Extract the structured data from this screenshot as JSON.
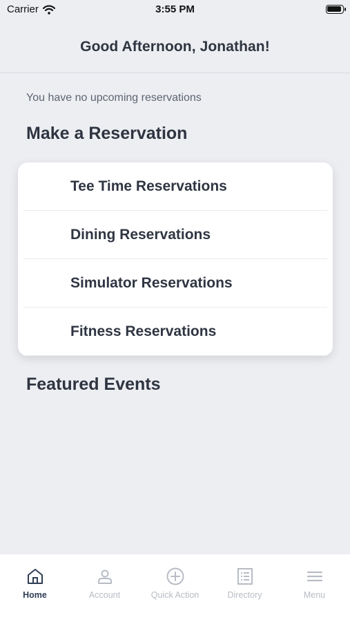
{
  "status_bar": {
    "carrier": "Carrier",
    "time": "3:55 PM"
  },
  "header": {
    "greeting": "Good Afternoon, Jonathan!"
  },
  "upcoming": {
    "empty_text": "You have no upcoming reservations"
  },
  "make_reservation": {
    "title": "Make a Reservation",
    "items": [
      {
        "label": "Tee Time Reservations"
      },
      {
        "label": "Dining Reservations"
      },
      {
        "label": "Simulator Reservations"
      },
      {
        "label": "Fitness Reservations"
      }
    ]
  },
  "featured": {
    "title": "Featured Events"
  },
  "tab_bar": {
    "tabs": [
      {
        "label": "Home",
        "icon": "home-icon",
        "active": true
      },
      {
        "label": "Account",
        "icon": "person-icon",
        "active": false
      },
      {
        "label": "Quick Action",
        "icon": "plus-circle-icon",
        "active": false
      },
      {
        "label": "Directory",
        "icon": "list-icon",
        "active": false
      },
      {
        "label": "Menu",
        "icon": "hamburger-icon",
        "active": false
      }
    ]
  },
  "colors": {
    "background": "#eceef2",
    "text_dark": "#2e3440",
    "tab_active": "#2f3e55",
    "tab_inactive": "#b7bcc4"
  }
}
